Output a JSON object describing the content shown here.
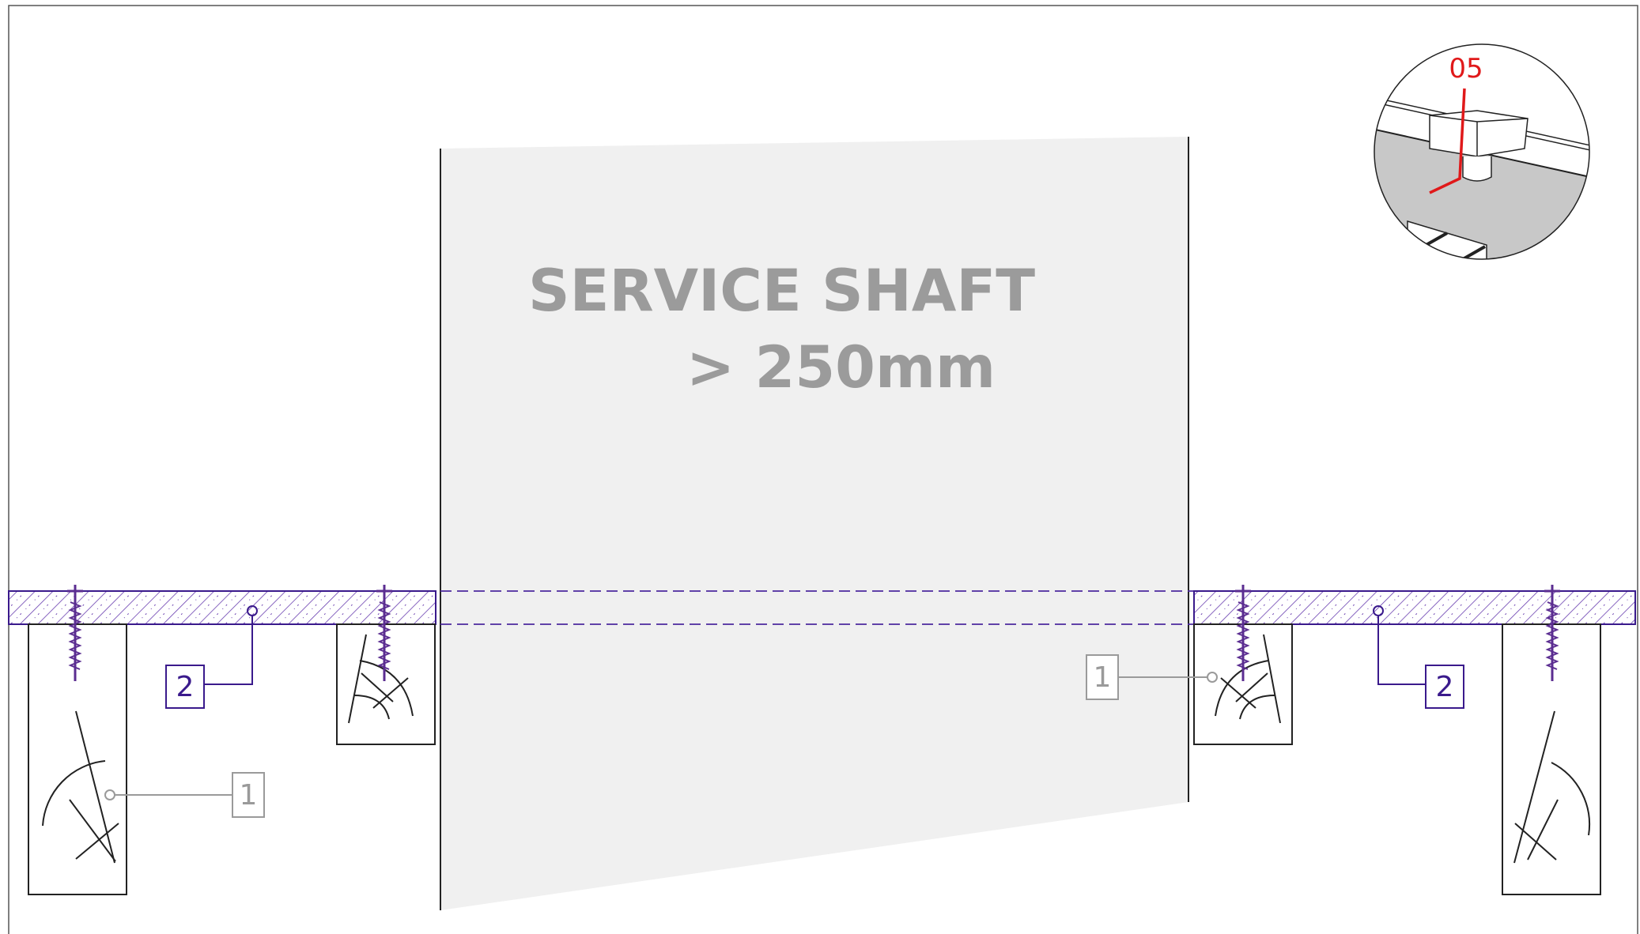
{
  "drawing": {
    "title_line1": "SERVICE SHAFT",
    "title_line2": "> 250mm",
    "detail_ref": "05"
  },
  "callouts": {
    "timber_joist": "1",
    "floor_board": "2"
  },
  "colors": {
    "board_outline": "#3a1a8c",
    "board_hatch": "#6a3fb0",
    "screw": "#5b2d91",
    "callout_grey": "#9a9a9a",
    "shaft_fill": "#f0f0f0",
    "detail_red": "#e0191a",
    "detail_grey": "#c8c8c8"
  }
}
